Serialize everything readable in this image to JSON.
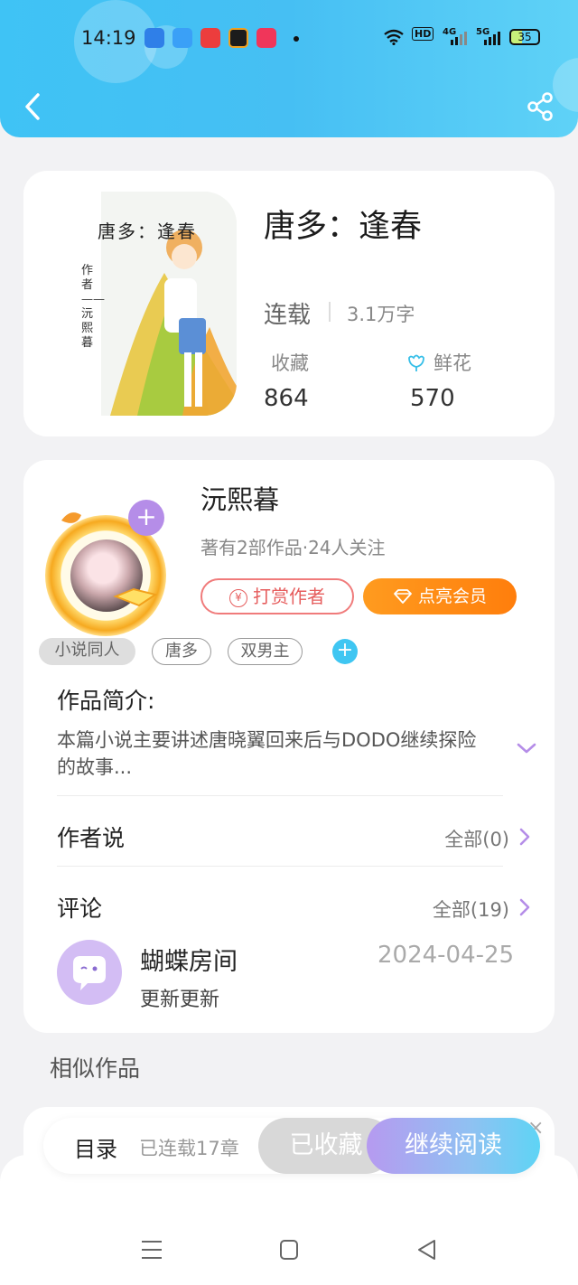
{
  "status_bar": {
    "time": "14:19",
    "network_labels": [
      "HD",
      "4G",
      "5G"
    ],
    "battery": "35"
  },
  "header": {
    "back_icon": "chevron-left-icon",
    "share_icon": "share-icon"
  },
  "book": {
    "cover_title": "唐多：逢春",
    "cover_side": "作者——沅熙暮",
    "title": "唐多：逢春",
    "status": "连载",
    "word_count": "3.1万字",
    "favorites_label": "收藏",
    "favorites_count": "864",
    "flowers_label": "鲜花",
    "flowers_count": "570"
  },
  "author": {
    "name": "沅熙暮",
    "meta": "著有2部作品·24人关注",
    "tip_label": "打赏作者",
    "tip_icon": "yen-icon",
    "vip_label": "点亮会员",
    "vip_icon": "diamond-icon",
    "follow_label": "+"
  },
  "tags": [
    "小说同人",
    "唐多",
    "双男主"
  ],
  "tag_add_label": "+",
  "intro": {
    "title": "作品简介:",
    "text": "本篇小说主要讲述唐晓翼回来后与DODO继续探险的故事..."
  },
  "author_says": {
    "title": "作者说",
    "more": "全部(0)"
  },
  "comments": {
    "title": "评论",
    "more": "全部(19)",
    "items": [
      {
        "user": "蝴蝶房间",
        "date": "2024-04-25",
        "text": "更新更新"
      }
    ]
  },
  "similar_title": "相似作品",
  "bottom_bar": {
    "toc": "目录",
    "chapters": "已连载17章",
    "favorited": "已收藏",
    "continue": "继续阅读"
  },
  "colors": {
    "header": "#46bff3",
    "accent_purple": "#b58de8",
    "vip_orange": "#ff8a15",
    "tip_red": "#e65d5d"
  }
}
